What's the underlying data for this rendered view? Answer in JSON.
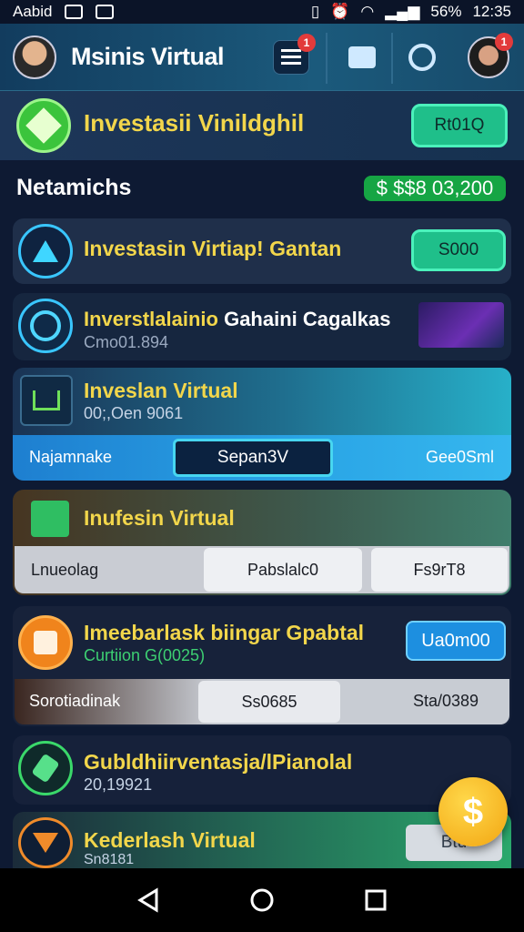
{
  "status": {
    "carrier": "Aabid",
    "battery": "56%",
    "time": "12:35"
  },
  "header": {
    "title": "Msinis Virtual",
    "menu_badge": "1",
    "avatar_badge": "1"
  },
  "banner": {
    "title": "Investasii Vinildghil",
    "button": "Rt01Q"
  },
  "section": {
    "title": "Netamichs",
    "balance": "$ $$8 03,200"
  },
  "items": [
    {
      "title": "Investasin Virtiap! Gantan",
      "button": "S000"
    },
    {
      "title_a": "Inverstlalainio",
      "title_b": "Gahaini Cagalkas",
      "sub": "Cmo01.894"
    },
    {
      "title": "Inveslan Virtual",
      "sub": "00;,Oen 9061",
      "row": {
        "left": "Najamnake",
        "mid": "Sepan3V",
        "right": "Gee0Sml"
      }
    },
    {
      "title": "Inufesin Virtual",
      "row": {
        "left": "Lnueolag",
        "mid": "Pabslalc0",
        "right": "Fs9rT8"
      }
    },
    {
      "title": "Imeebarlask biingar Gpabtal",
      "sub": "Curtiion G(0025)",
      "button": "Ua0m00",
      "row": {
        "left": "Sorotiadinak",
        "mid": "Ss0685",
        "right": "Sta/0389"
      }
    },
    {
      "title": "Gubldhiirventasja/lPianolal",
      "sub": "20,19921"
    },
    {
      "title": "Kederlash Virtual",
      "sub": "Sn8181",
      "button": "Btu"
    }
  ],
  "fab": {
    "symbol": "$"
  }
}
